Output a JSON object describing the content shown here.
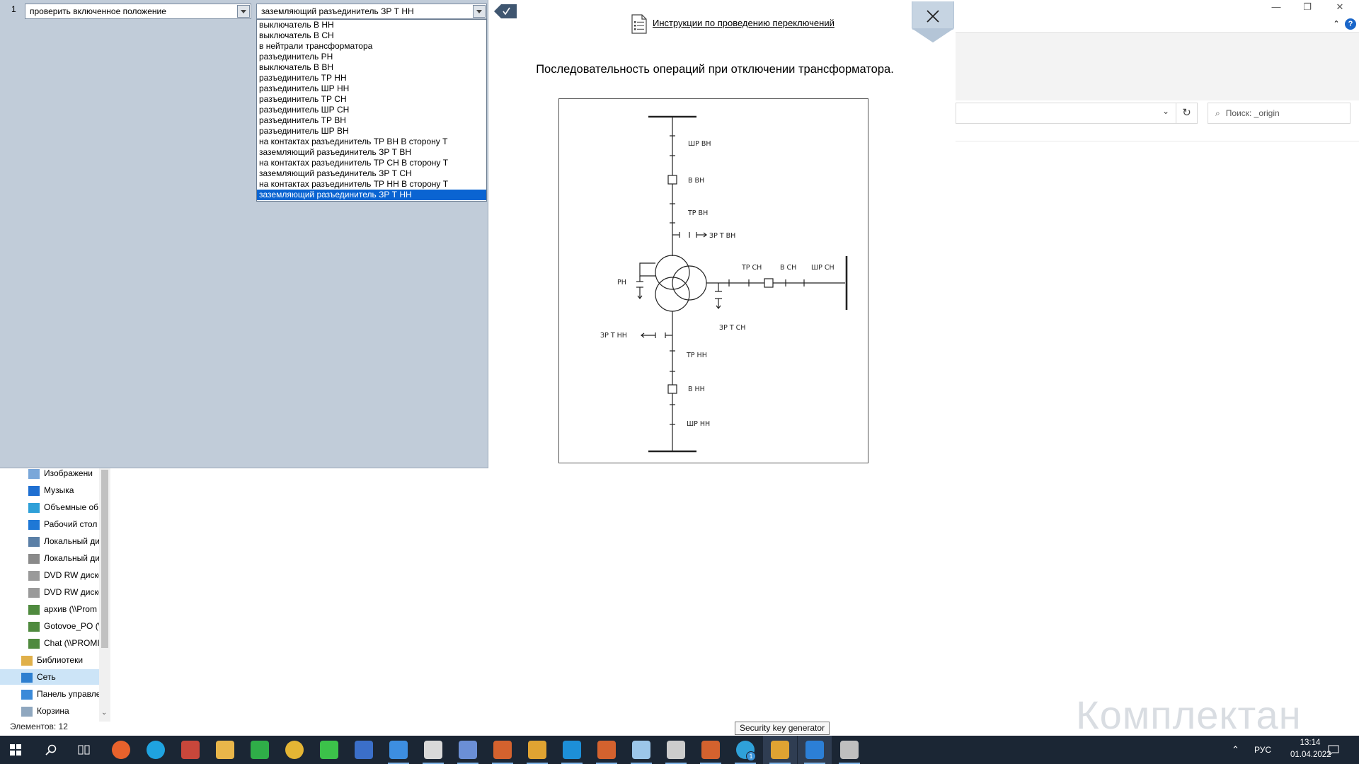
{
  "row": {
    "number": "1",
    "action_value": "проверить включенное положение",
    "target_value": "заземляющий разъединитель ЗР Т НН",
    "options": [
      "выключатель В НН",
      "выключатель В СН",
      "в нейтрали трансформатора",
      "разъединитель РН",
      "выключатель В ВН",
      "разъединитель ТР НН",
      "разъединитель ШР НН",
      "разъединитель ТР СН",
      "разъединитель ШР СН",
      "разъединитель ТР ВН",
      "разъединитель ШР ВН",
      "на контактах разъединитель ТР ВН В сторону Т",
      "заземляющий разъединитель ЗР Т ВН",
      "на контактах разъединитель ТР СН В сторону Т",
      "заземляющий разъединитель ЗР Т СН",
      "на контактах разъединитель ТР НН В сторону Т",
      "заземляющий разъединитель ЗР Т НН"
    ],
    "selected_index": 16
  },
  "window": {
    "instructions_link": "Инструкции по проведению переключений",
    "heading": "Последовательность операций при  отключении трансформатора."
  },
  "diagram": {
    "labels": {
      "shr_vn": "ШР ВН",
      "v_vn": "В ВН",
      "tr_vn": "ТР ВН",
      "zr_t_vn": "ЗР Т ВН",
      "rn": "РН",
      "tr_sn": "ТР СН",
      "v_sn": "В СН",
      "shr_sn": "ШР СН",
      "zr_t_sn": "ЗР Т СН",
      "zr_t_nn": "ЗР Т НН",
      "tr_nn": "ТР НН",
      "v_nn": "В НН",
      "shr_nn": "ШР НН"
    }
  },
  "explorer": {
    "search_placeholder": "Поиск: _origin",
    "nav_items": [
      {
        "label": "Изображени",
        "icon": "pictures-icon",
        "color": "#7aa7d9"
      },
      {
        "label": "Музыка",
        "icon": "music-icon",
        "color": "#1f6fd1"
      },
      {
        "label": "Объемные об",
        "icon": "3d-objects-icon",
        "color": "#2fa0d8"
      },
      {
        "label": "Рабочий стол",
        "icon": "desktop-icon",
        "color": "#1e78d6"
      },
      {
        "label": "Локальный ди",
        "icon": "local-disk-icon",
        "color": "#5b7fa6"
      },
      {
        "label": "Локальный ди",
        "icon": "local-disk-icon",
        "color": "#8a8a8a"
      },
      {
        "label": "DVD RW диско",
        "icon": "dvd-drive-icon",
        "color": "#9a9a9a"
      },
      {
        "label": "DVD RW диско",
        "icon": "dvd-drive-icon",
        "color": "#9a9a9a"
      },
      {
        "label": "архив (\\\\Prom",
        "icon": "network-drive-icon",
        "color": "#4f8a3e"
      },
      {
        "label": "Gotovoe_PO (\\",
        "icon": "network-drive-icon",
        "color": "#4f8a3e"
      },
      {
        "label": "Chat (\\\\PROMI",
        "icon": "network-drive-icon",
        "color": "#4f8a3e"
      },
      {
        "label": "Библиотеки",
        "icon": "libraries-icon",
        "color": "#e0b04a"
      },
      {
        "label": "Сеть",
        "icon": "network-icon",
        "color": "#2e7fd0"
      },
      {
        "label": "Панель управле",
        "icon": "control-panel-icon",
        "color": "#3b8ad9"
      },
      {
        "label": "Корзина",
        "icon": "recycle-bin-icon",
        "color": "#8fa7bf"
      }
    ],
    "selected_nav": 12,
    "status": "Элементов: 12"
  },
  "tooltip": "Security key generator",
  "watermark": "Комплектан",
  "taskbar": {
    "lang": "РУС",
    "time": "13:14",
    "date": "01.04.2022",
    "telegram_badge": "1",
    "icons": [
      {
        "name": "firefox-icon",
        "color": "#e8622c"
      },
      {
        "name": "edge-icon",
        "color": "#1fa3e0"
      },
      {
        "name": "app-icon-red",
        "color": "#c8473b"
      },
      {
        "name": "file-explorer-icon",
        "color": "#e9b64a"
      },
      {
        "name": "phone-app-icon",
        "color": "#2fae48"
      },
      {
        "name": "chrome-icon",
        "color": "#e4b534"
      },
      {
        "name": "clover-icon",
        "color": "#3cc24a"
      },
      {
        "name": "floppy-icon",
        "color": "#3b6fc9"
      },
      {
        "name": "outlook-icon",
        "color": "#3d8ee0"
      },
      {
        "name": "bars-app-icon",
        "color": "#d9d9d9"
      },
      {
        "name": "network-app-icon",
        "color": "#6b8fd6"
      },
      {
        "name": "scheme-app-icon-1",
        "color": "#d4622e"
      },
      {
        "name": "scheme-app-icon-2",
        "color": "#e0a332"
      },
      {
        "name": "autodesk-icon",
        "color": "#1d8fd8"
      },
      {
        "name": "scheme-app-icon-3",
        "color": "#d4622e"
      },
      {
        "name": "notepad-icon",
        "color": "#9cc6e9"
      },
      {
        "name": "alpha-app-icon",
        "color": "#cccccc"
      },
      {
        "name": "scheme-app-icon-4",
        "color": "#d4622e"
      },
      {
        "name": "telegram-icon",
        "color": "#2fa1d9"
      },
      {
        "name": "scheme-app-icon-5",
        "color": "#e0a332"
      },
      {
        "name": "lightning-app-icon",
        "color": "#2c7fd6"
      },
      {
        "name": "paint-app-icon",
        "color": "#bfbfbf"
      }
    ]
  }
}
